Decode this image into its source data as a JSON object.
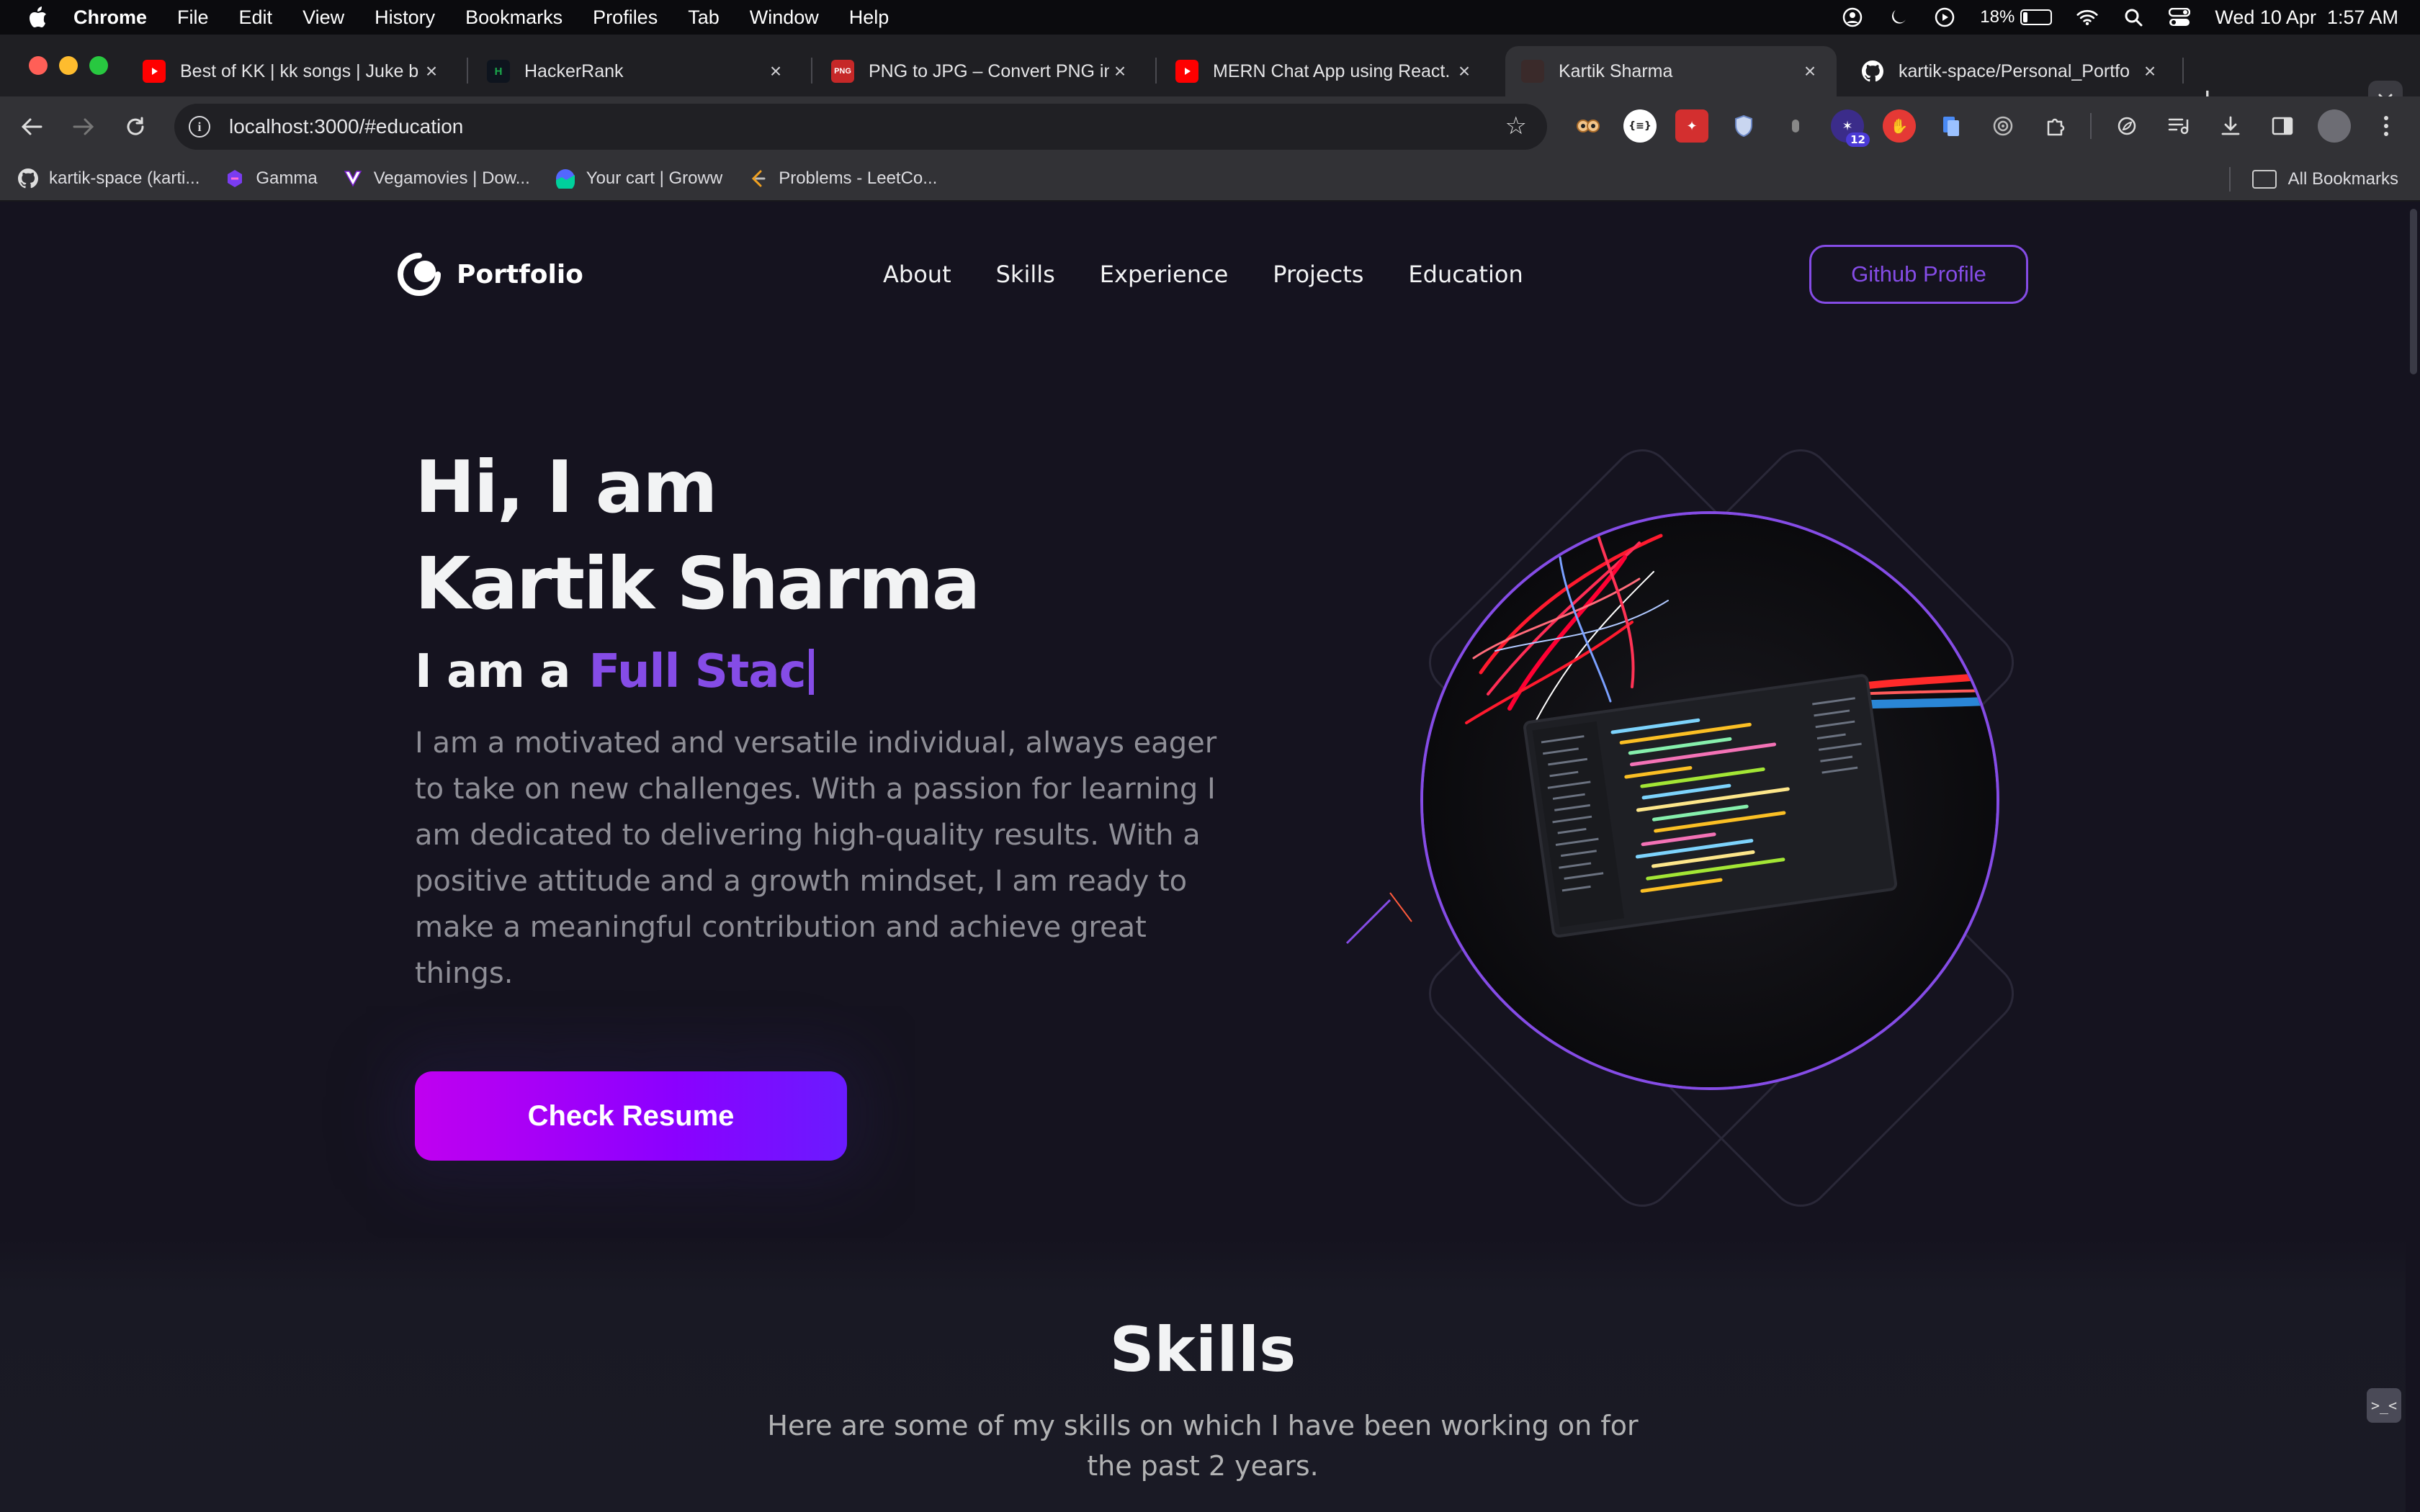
{
  "menubar": {
    "app": "Chrome",
    "items": [
      "File",
      "Edit",
      "View",
      "History",
      "Bookmarks",
      "Profiles",
      "Tab",
      "Window",
      "Help"
    ],
    "battery_text": "18%",
    "battery_level": 0.18,
    "datetime": "Wed 10 Apr  1:57 AM"
  },
  "tabs": [
    {
      "title": "Best of KK | kk songs | Juke b",
      "icon": "youtube-icon",
      "color": "#ff0000"
    },
    {
      "title": "HackerRank",
      "icon": "hackerrank-icon",
      "color": "#0e141e"
    },
    {
      "title": "PNG to JPG – Convert PNG in",
      "icon": "png-jpg-icon",
      "color": "#c62828"
    },
    {
      "title": "MERN Chat App using React.",
      "icon": "youtube-icon",
      "color": "#ff0000"
    },
    {
      "title": "Kartik Sharma",
      "icon": "portfolio-favicon",
      "color": "#3a2a2a"
    },
    {
      "title": "kartik-space/Personal_Portfo",
      "icon": "github-icon",
      "color": "#ffffff"
    }
  ],
  "toolbar": {
    "url": "localhost:3000/#education",
    "ext_badge": "12"
  },
  "bookmarks": [
    {
      "label": "kartik-space (karti...",
      "icon": "github-icon"
    },
    {
      "label": "Gamma",
      "icon": "gamma-icon"
    },
    {
      "label": "Vegamovies | Dow...",
      "icon": "vegamovies-icon"
    },
    {
      "label": "Your cart | Groww",
      "icon": "groww-icon"
    },
    {
      "label": "Problems - LeetCo...",
      "icon": "leetcode-icon"
    }
  ],
  "bookmarks_all": "All Bookmarks",
  "site": {
    "brand": "Portfolio",
    "nav": [
      "About",
      "Skills",
      "Experience",
      "Projects",
      "Education"
    ],
    "github_button": "Github Profile",
    "greeting": "Hi, I am",
    "name": "Kartik Sharma",
    "typer_prefix": "I am a",
    "typer_role": "Full Stac",
    "description": "I am a motivated and versatile individual, always eager to take on new challenges. With a passion for learning I am dedicated to delivering high-quality results. With a positive attitude and a growth mindset, I am ready to make a meaningful contribution and achieve great things.",
    "resume_button": "Check Resume",
    "skills_title": "Skills",
    "skills_desc": "Here are some of my skills on which I have been working on for the past 2 years."
  },
  "colors": {
    "accent": "#854ce6",
    "bg": "#15131f",
    "resume_gradient_start": "#c000f0",
    "resume_gradient_end": "#6a1bff"
  }
}
